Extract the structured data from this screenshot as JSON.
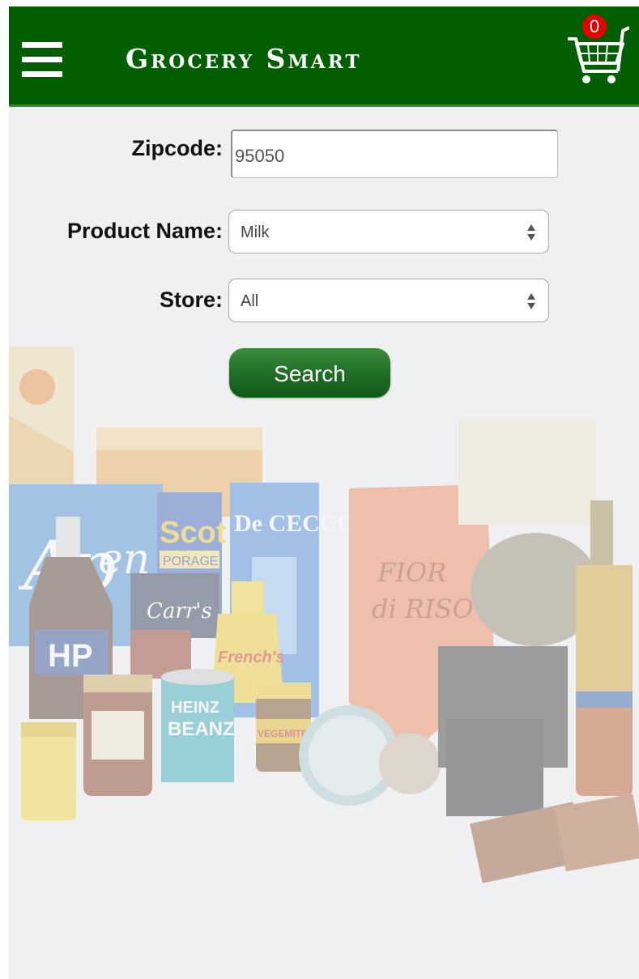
{
  "header": {
    "title": "Grocery Smart",
    "menu_icon": "hamburger-menu-icon",
    "cart_icon": "shopping-cart-icon",
    "cart_count": "0",
    "background_color": "#015f02",
    "badge_color": "#e60000"
  },
  "form": {
    "zipcode": {
      "label": "Zipcode:",
      "value": "95050"
    },
    "product": {
      "label": "Product Name:",
      "selected": "Milk"
    },
    "store": {
      "label": "Store:",
      "selected": "All"
    },
    "search_label": "Search"
  },
  "products_in_image": {
    "hp": "HP",
    "scot": "Scot",
    "porage": "PORAGE",
    "carrs": "Carr's",
    "frenchs": "French's",
    "heinz": "HEINZ",
    "beanz": "BEANZ",
    "vegemite": "VEGEMITE",
    "dececco": "De CECCO",
    "fior_di_riso": "FIOR di RISO"
  }
}
